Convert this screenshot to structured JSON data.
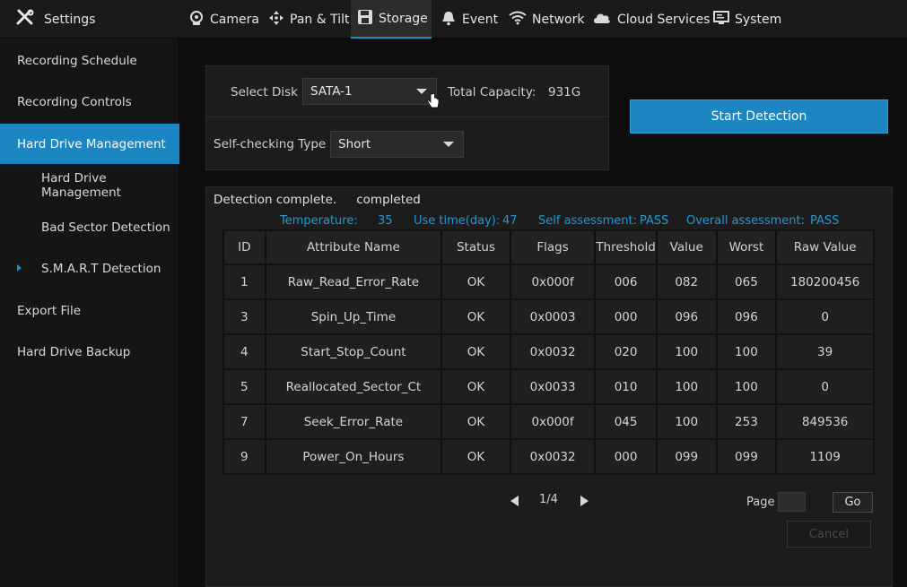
{
  "header": {
    "settings_label": "Settings",
    "tabs": [
      {
        "label": "Camera",
        "icon": "camera-icon"
      },
      {
        "label": "Pan & Tilt",
        "icon": "pan-tilt-icon"
      },
      {
        "label": "Storage",
        "icon": "storage-icon",
        "active": true
      },
      {
        "label": "Event",
        "icon": "bell-icon"
      },
      {
        "label": "Network",
        "icon": "wifi-icon"
      },
      {
        "label": "Cloud Services",
        "icon": "cloud-icon"
      },
      {
        "label": "System",
        "icon": "monitor-icon"
      }
    ]
  },
  "sidebar": {
    "items": [
      {
        "label": "Recording Schedule"
      },
      {
        "label": "Recording Controls"
      },
      {
        "label": "Hard Drive Management",
        "active": true
      },
      {
        "label": "Hard Drive Management"
      },
      {
        "label": "Bad Sector Detection"
      },
      {
        "label": "S.M.A.R.T Detection"
      },
      {
        "label": "Export File"
      },
      {
        "label": "Hard Drive Backup"
      }
    ]
  },
  "disk": {
    "select_disk_label": "Select Disk",
    "select_disk_value": "SATA-1",
    "total_capacity_label": "Total Capacity:",
    "total_capacity_value": "931G",
    "self_check_label": "Self-checking Type",
    "self_check_value": "Short",
    "start_button": "Start Detection"
  },
  "result": {
    "status_label": "Detection complete.",
    "status_value": "completed",
    "temperature_label": "Temperature:",
    "temperature_value": "35",
    "use_time_label": "Use time(day):",
    "use_time_value": "47",
    "self_assessment_label": "Self assessment:",
    "self_assessment_value": "PASS",
    "overall_assessment_label": "Overall assessment:",
    "overall_assessment_value": "PASS"
  },
  "table": {
    "headers": [
      "ID",
      "Attribute Name",
      "Status",
      "Flags",
      "Threshold",
      "Value",
      "Worst",
      "Raw Value"
    ],
    "rows": [
      [
        "1",
        "Raw_Read_Error_Rate",
        "OK",
        "0x000f",
        "006",
        "082",
        "065",
        "180200456"
      ],
      [
        "3",
        "Spin_Up_Time",
        "OK",
        "0x0003",
        "000",
        "096",
        "096",
        "0"
      ],
      [
        "4",
        "Start_Stop_Count",
        "OK",
        "0x0032",
        "020",
        "100",
        "100",
        "39"
      ],
      [
        "5",
        "Reallocated_Sector_Ct",
        "OK",
        "0x0033",
        "010",
        "100",
        "100",
        "0"
      ],
      [
        "7",
        "Seek_Error_Rate",
        "OK",
        "0x000f",
        "045",
        "100",
        "253",
        "849536"
      ],
      [
        "9",
        "Power_On_Hours",
        "OK",
        "0x0032",
        "000",
        "099",
        "099",
        "1109"
      ]
    ]
  },
  "pager": {
    "page_text": "1/4",
    "page_label": "Page",
    "page_input_value": "",
    "go_label": "Go",
    "cancel_label": "Cancel"
  },
  "colors": {
    "accent": "#1b86c2",
    "info_text": "#1f9ad6",
    "background": "#0e0e0e",
    "panel": "#1c1c1c"
  }
}
